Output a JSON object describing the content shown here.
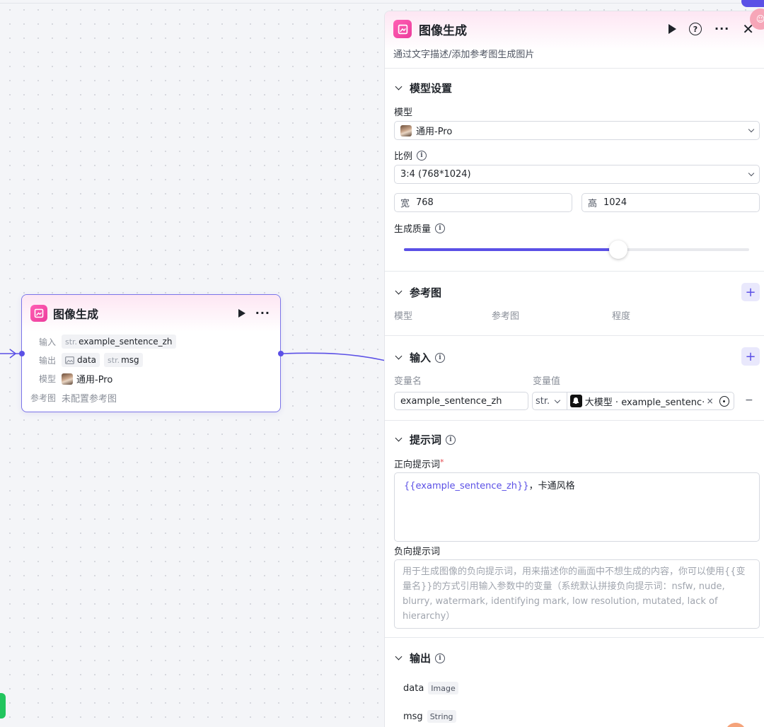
{
  "node": {
    "title": "图像生成",
    "rows": {
      "input_label": "输入",
      "input_type": "str.",
      "input_value": "example_sentence_zh",
      "output_label": "输出",
      "output_data": "data",
      "output_msg_type": "str.",
      "output_msg": "msg",
      "model_label": "模型",
      "model_value": "通用-Pro",
      "ref_label": "参考图",
      "ref_value": "未配置参考图"
    }
  },
  "panel": {
    "title": "图像生成",
    "description": "通过文字描述/添加参考图生成图片",
    "model_section": {
      "title": "模型设置",
      "model_label": "模型",
      "model_value": "通用-Pro",
      "ratio_label": "比例",
      "ratio_value": "3:4 (768*1024)",
      "width_label": "宽",
      "width_value": "768",
      "height_label": "高",
      "height_value": "1024",
      "quality_label": "生成质量",
      "quality_fraction": 0.62
    },
    "ref_section": {
      "title": "参考图",
      "col_model": "模型",
      "col_ref": "参考图",
      "col_degree": "程度"
    },
    "input_section": {
      "title": "输入",
      "col_name": "变量名",
      "col_value": "变量值",
      "var_name": "example_sentence_zh",
      "var_type": "str.",
      "var_ref": "大模型 · example_sentenc···",
      "remove": "×",
      "minus": "−"
    },
    "prompt_section": {
      "title": "提示词",
      "positive_label": "正向提示词",
      "required_mark": "*",
      "positive_var": "{{example_sentence_zh}}",
      "positive_rest": "，卡通风格",
      "negative_label": "负向提示词",
      "negative_placeholder": "用于生成图像的负向提示词，用来描述你的画面中不想生成的内容，你可以使用{{变量名}}的方式引用输入参数中的变量（系统默认拼接负向提示词：nsfw, nude, blurry, watermark, identifying mark, low resolution, mutated, lack of hierarchy）"
    },
    "output_section": {
      "title": "输出",
      "outputs": [
        {
          "name": "data",
          "type": "Image"
        },
        {
          "name": "msg",
          "type": "String"
        }
      ]
    }
  },
  "colors": {
    "accent": "#5b50e6",
    "logo_pink": "#ec3c9c",
    "border": "#d6d9e0"
  }
}
